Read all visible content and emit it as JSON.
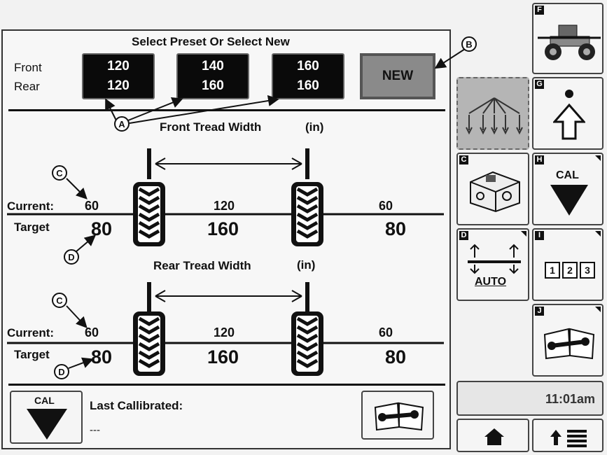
{
  "preset_panel": {
    "title": "Select Preset Or Select New",
    "front_label": "Front",
    "rear_label": "Rear",
    "presets": [
      {
        "front": "120",
        "rear": "120"
      },
      {
        "front": "140",
        "rear": "160"
      },
      {
        "front": "160",
        "rear": "160"
      }
    ],
    "new_label": "NEW"
  },
  "front_tread": {
    "title": "Front Tread Width",
    "unit": "(in)",
    "current_label": "Current:",
    "target_label": "Target",
    "current_left": "60",
    "current_center": "120",
    "current_right": "60",
    "target_left": "80",
    "target_center": "160",
    "target_right": "80"
  },
  "rear_tread": {
    "title": "Rear Tread Width",
    "unit": "(in)",
    "current_label": "Current:",
    "target_label": "Target",
    "current_left": "60",
    "current_center": "120",
    "current_right": "60",
    "target_left": "80",
    "target_center": "160",
    "target_right": "80"
  },
  "calibration": {
    "cal_label": "CAL",
    "last_calibrated_label": "Last Callibrated:",
    "last_calibrated_value": "---"
  },
  "callouts": {
    "a": "A",
    "b": "B",
    "c": "C",
    "d": "D"
  },
  "side_buttons": {
    "f": "F",
    "g": "G",
    "c": "C",
    "h": "H",
    "h_label": "CAL",
    "d": "D",
    "d_label": "AUTO",
    "i": "I",
    "i_digits": [
      "1",
      "2",
      "3"
    ],
    "j": "J"
  },
  "status": {
    "time": "11:01am"
  },
  "colors": {
    "preset_bg": "#0a0a0a",
    "new_bg": "#8a8a8a",
    "selected_side_bg": "#b5b5b5"
  },
  "icons": {
    "sprayer": "sprayer-vehicle-icon",
    "boom": "boom-spray-icon",
    "up_arrow": "up-arrow-icon",
    "engine": "engine-icon",
    "cal_down": "cal-down-arrow-icon",
    "auto_boom": "auto-boom-height-icon",
    "numbers": "number-keypad-icon",
    "manual": "service-manual-icon",
    "home": "home-icon",
    "menu": "menu-list-icon"
  }
}
